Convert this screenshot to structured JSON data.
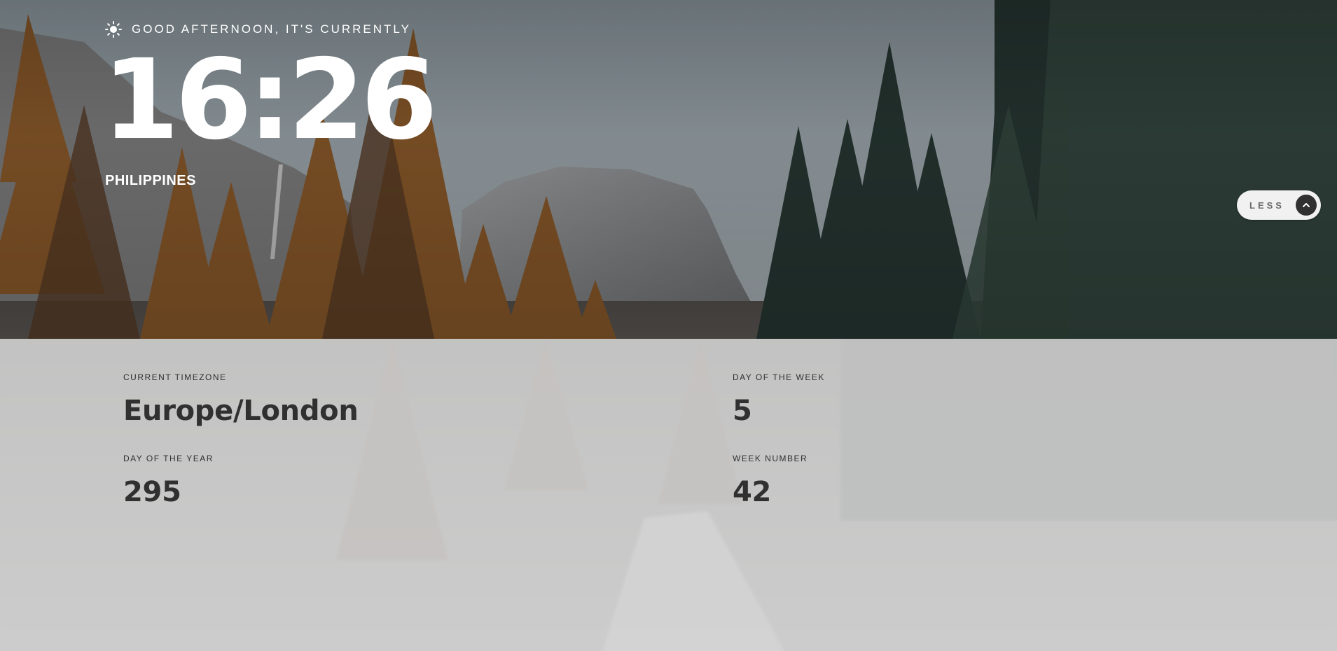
{
  "header": {
    "greeting": "GOOD AFTERNOON, IT'S CURRENTLY",
    "greeting_icon": "sun-icon",
    "time": "16:26",
    "location": "PHILIPPINES"
  },
  "toggle": {
    "label": "LESS",
    "icon": "chevron-up-icon"
  },
  "details": {
    "timezone_label": "CURRENT TIMEZONE",
    "timezone_value": "Europe/London",
    "day_of_year_label": "DAY OF THE YEAR",
    "day_of_year_value": "295",
    "day_of_week_label": "DAY OF THE WEEK",
    "day_of_week_value": "5",
    "week_number_label": "WEEK NUMBER",
    "week_number_value": "42"
  },
  "colors": {
    "text_light": "#ffffff",
    "text_dark": "#303030",
    "panel_bg": "#d6d6d6",
    "button_bg": "#f1f1f1",
    "button_icon_bg": "#303030"
  }
}
